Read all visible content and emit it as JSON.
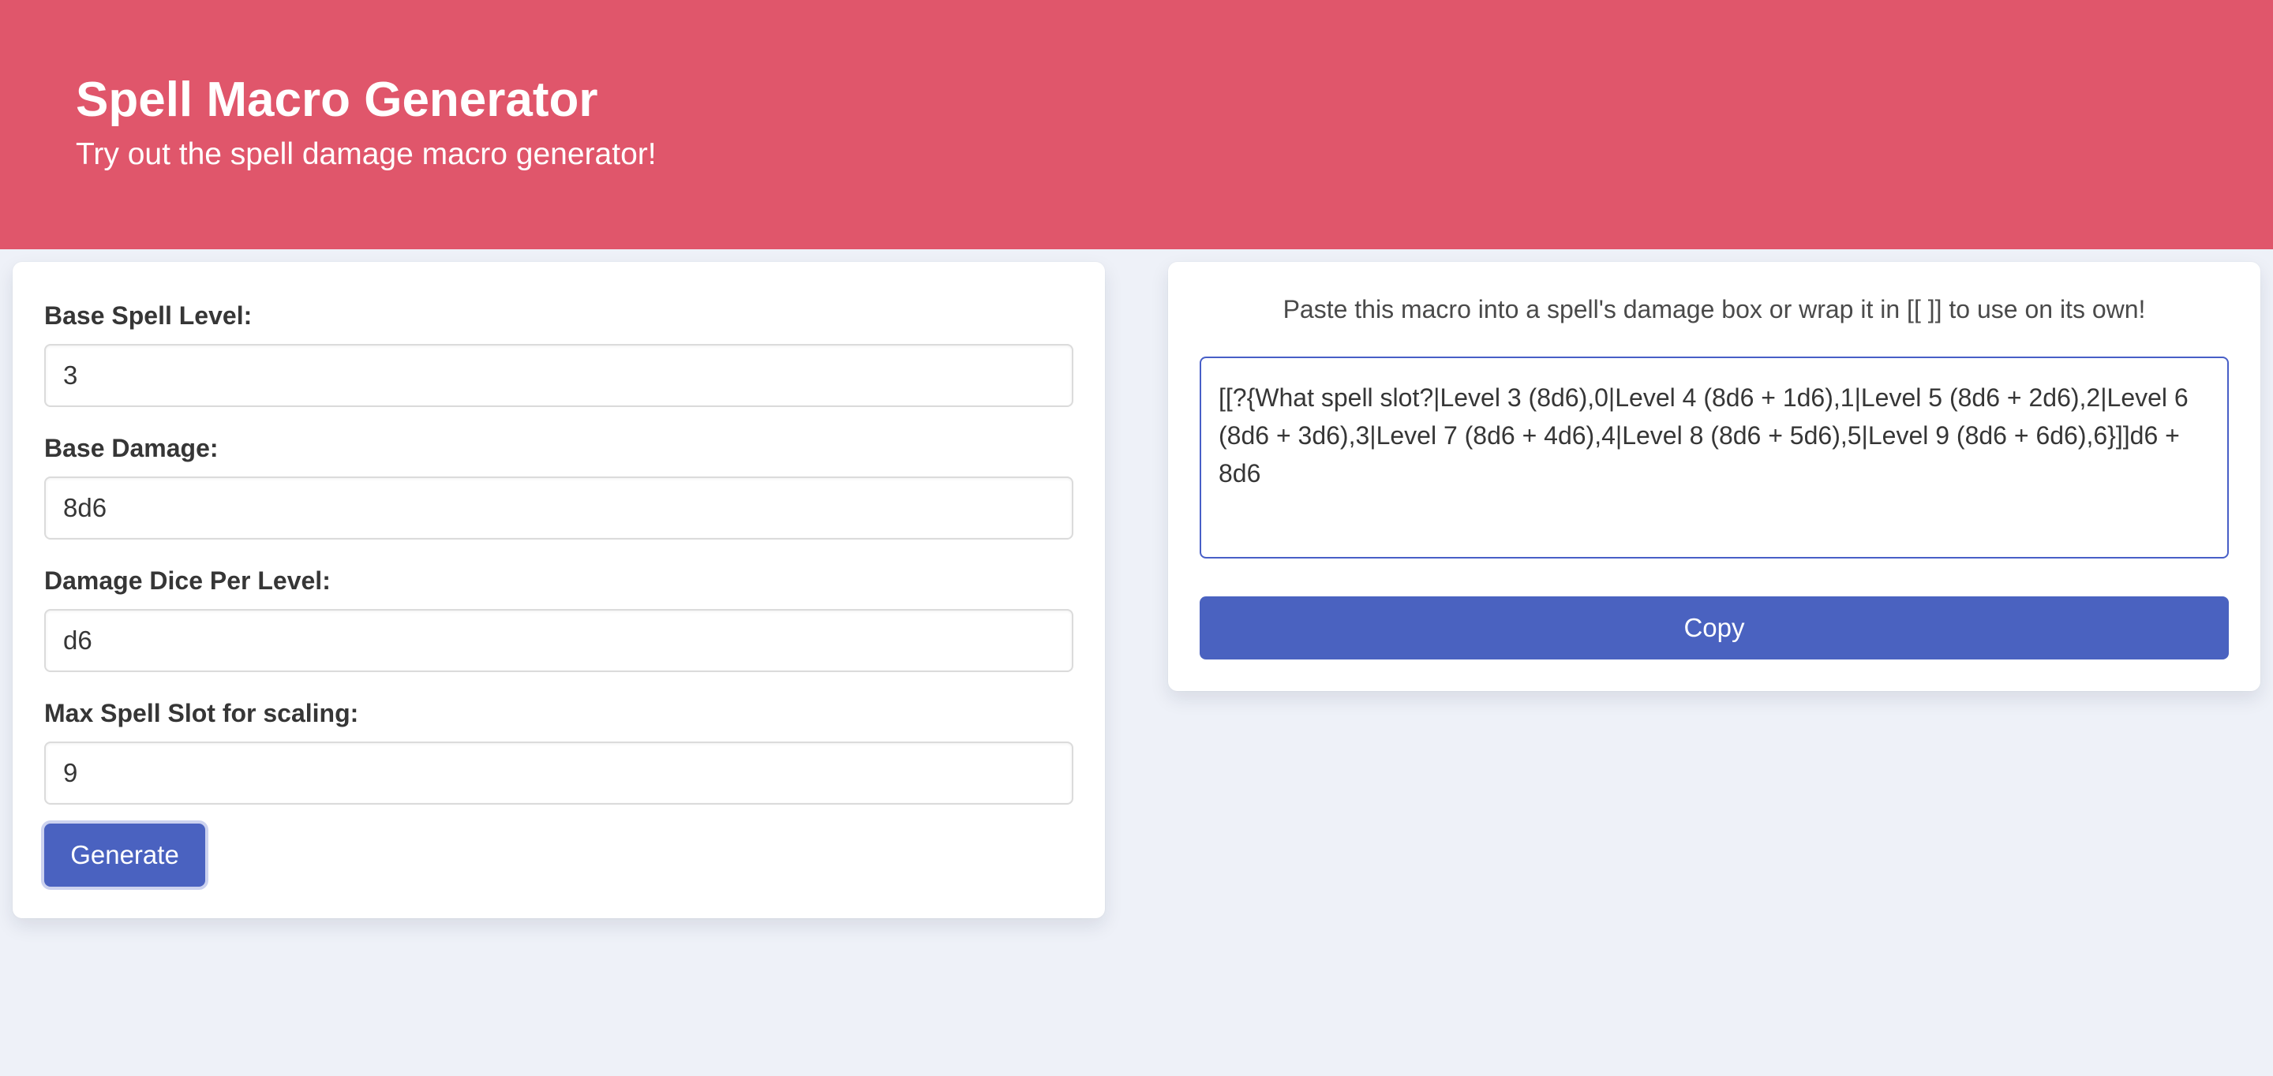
{
  "hero": {
    "title": "Spell Macro Generator",
    "subtitle": "Try out the spell damage macro generator!"
  },
  "form": {
    "fields": [
      {
        "label": "Base Spell Level:",
        "value": "3"
      },
      {
        "label": "Base Damage:",
        "value": "8d6"
      },
      {
        "label": "Damage Dice Per Level:",
        "value": "d6"
      },
      {
        "label": "Max Spell Slot for scaling:",
        "value": "9"
      }
    ],
    "generate_label": "Generate"
  },
  "output": {
    "instructions": "Paste this macro into a spell's damage box or wrap it in [[ ]] to use on its own!",
    "macro": "[[?{What spell slot?|Level 3 (8d6),0|Level 4 (8d6 + 1d6),1|Level 5 (8d6 + 2d6),2|Level 6 (8d6 + 3d6),3|Level 7 (8d6 + 4d6),4|Level 8 (8d6 + 5d6),5|Level 9 (8d6 + 6d6),6}]]d6 + 8d6",
    "copy_label": "Copy"
  },
  "colors": {
    "hero_background": "#e0566b",
    "page_background": "#eef1f8",
    "button_primary": "#4a62c0",
    "focus_border": "#485fc7"
  }
}
